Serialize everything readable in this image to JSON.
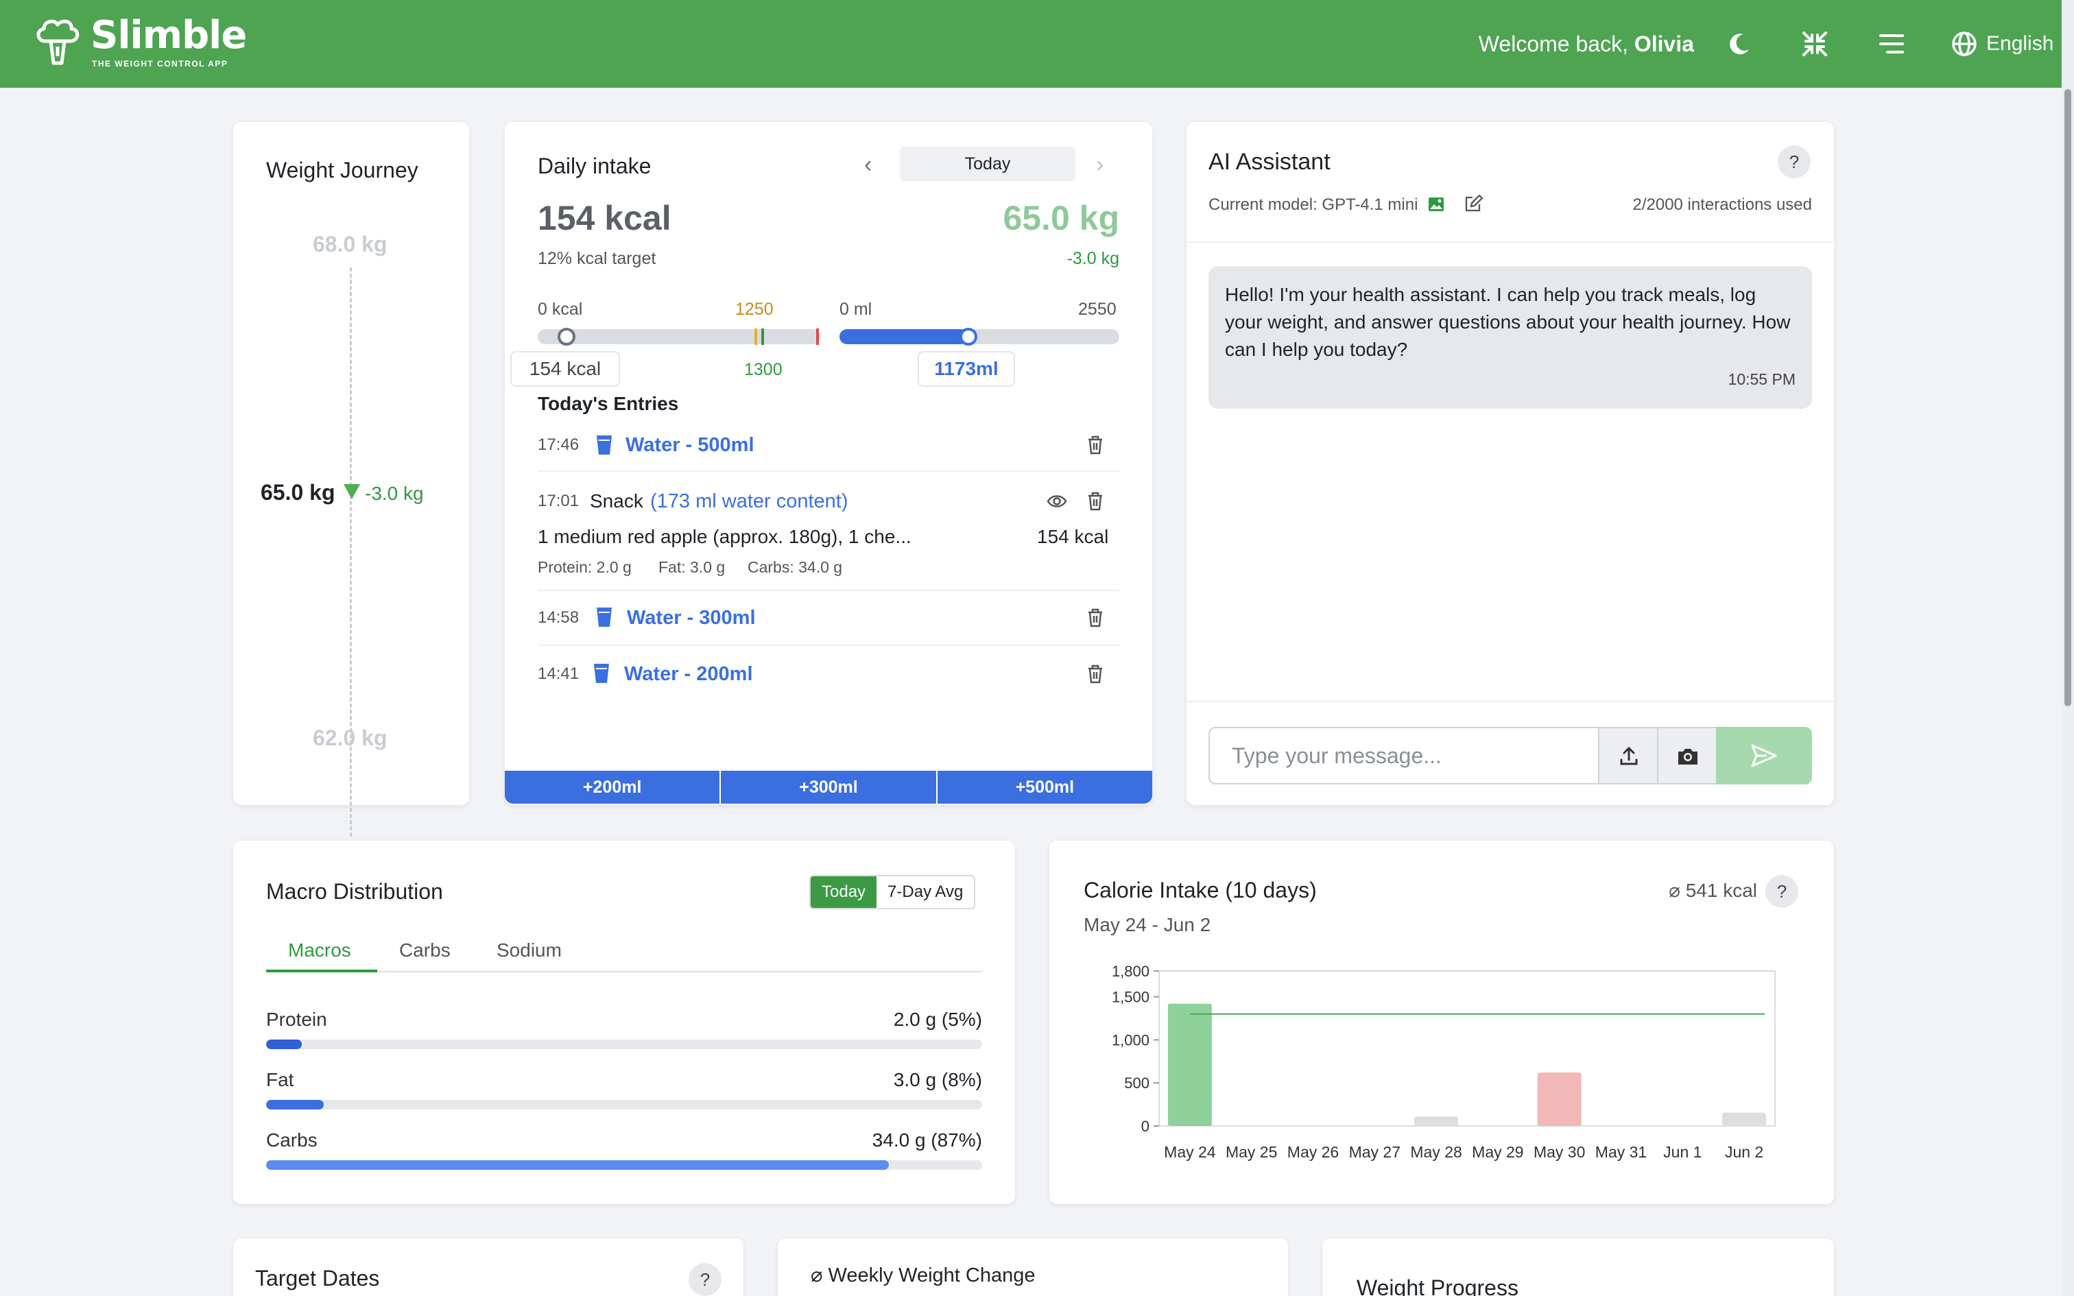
{
  "header": {
    "brand": "Slimble",
    "tagline": "THE WEIGHT CONTROL APP",
    "welcome_prefix": "Welcome back, ",
    "user_name": "Olivia",
    "language": "English"
  },
  "weight_journey": {
    "title": "Weight Journey",
    "top_label": "68.0 kg",
    "current": "65.0 kg",
    "delta": "-3.0 kg",
    "bottom_label": "62.0 kg"
  },
  "daily_intake": {
    "title": "Daily intake",
    "date_button": "Today",
    "kcal": "154 kcal",
    "kcal_target_pct": "12% kcal target",
    "weight": "65.0 kg",
    "weight_delta": "-3.0 kg",
    "kcal_bar": {
      "min_label": "0 kcal",
      "mid_label": "1250",
      "target_label": "1300",
      "value_label": "154 kcal",
      "value": 154,
      "max": 1500
    },
    "water_bar": {
      "min_label": "0 ml",
      "max_label": "2550",
      "value_label": "1173ml",
      "value": 1173,
      "max": 2550
    },
    "entries_title": "Today's Entries",
    "entries": [
      {
        "time": "17:46",
        "label": "Water - 500ml"
      },
      {
        "time": "17:01",
        "type": "Snack",
        "water": "(173 ml water content)",
        "description": "1 medium red apple (approx. 180g), 1 che...",
        "kcal": "154 kcal",
        "protein": "Protein: 2.0 g",
        "fat": "Fat: 3.0 g",
        "carbs": "Carbs: 34.0 g"
      },
      {
        "time": "14:58",
        "label": "Water - 300ml"
      },
      {
        "time": "14:41",
        "label": "Water - 200ml"
      }
    ],
    "quick_add": [
      "+200ml",
      "+300ml",
      "+500ml"
    ]
  },
  "ai_assistant": {
    "title": "AI Assistant",
    "model_label": "Current model: GPT-4.1 mini",
    "usage": "2/2000 interactions used",
    "message": "Hello! I'm your health assistant. I can help you track meals, log your weight, and answer questions about your health journey. How can I help you today?",
    "message_time": "10:55 PM",
    "input_placeholder": "Type your message..."
  },
  "macro": {
    "title": "Macro Distribution",
    "toggle": [
      "Today",
      "7-Day Avg"
    ],
    "tabs": [
      "Macros",
      "Carbs",
      "Sodium"
    ],
    "rows": [
      {
        "label": "Protein",
        "value": "2.0 g (5%)",
        "pct": 5,
        "color": "#2f5fd6"
      },
      {
        "label": "Fat",
        "value": "3.0 g (8%)",
        "pct": 8,
        "color": "#3b6fe0"
      },
      {
        "label": "Carbs",
        "value": "34.0 g (87%)",
        "pct": 87,
        "color": "#5b8def"
      }
    ]
  },
  "calorie": {
    "title": "Calorie Intake (10 days)",
    "average": "⌀ 541 kcal",
    "range": "May 24 - Jun 2"
  },
  "chart_data": {
    "type": "bar",
    "title": "Calorie Intake (10 days)",
    "categories": [
      "May 24",
      "May 25",
      "May 26",
      "May 27",
      "May 28",
      "May 29",
      "May 30",
      "May 31",
      "Jun 1",
      "Jun 2"
    ],
    "values": [
      1420,
      0,
      0,
      0,
      110,
      0,
      620,
      0,
      0,
      154
    ],
    "bar_colors": [
      "#8fd19a",
      "#dcdee2",
      "#dcdee2",
      "#dcdee2",
      "#dcdee2",
      "#dcdee2",
      "#f2b8b8",
      "#dcdee2",
      "#dcdee2",
      "#dcdee2"
    ],
    "target_line": 1300,
    "ylim": [
      0,
      1800
    ],
    "yticks": [
      0,
      500,
      1000,
      1500,
      1800
    ],
    "ytick_labels": [
      "0",
      "500",
      "1,000",
      "1,500",
      "1,800"
    ],
    "grid": false
  },
  "bottom": {
    "target_dates": "Target Dates",
    "weekly_change": "⌀ Weekly Weight Change",
    "weight_progress": "Weight Progress"
  },
  "colors": {
    "brand_green": "#4fa452",
    "accent_blue": "#3b6fe0"
  }
}
